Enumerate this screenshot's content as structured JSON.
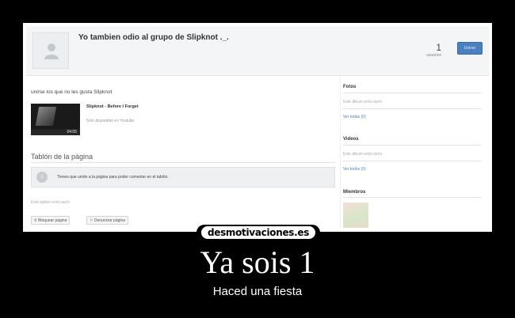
{
  "screenshot": {
    "group_title": "Yo tambien odio al grupo de Slipknot ._.",
    "member_count": "1",
    "member_label": "usuarios",
    "join_label": "Unirse",
    "description": "unirse los que no les gusta Slipknot",
    "video": {
      "title": "Slipknot - Before I Forget",
      "duration": "04:05",
      "note": "Sólo disponible en Youtube"
    },
    "wall": {
      "title": "Tablón de la página",
      "notice": "Tienes que unirte a la página para poder comentar en el tablón.",
      "empty": "Este tablón está vacío",
      "block_button": "Bloquear página",
      "report_button": "Denunciar página"
    },
    "sidebar": {
      "photos": {
        "title": "Fotos",
        "empty": "Este álbum está vacío",
        "link": "Ver todas (0)"
      },
      "videos": {
        "title": "Videos",
        "empty": "Este álbum está vacío",
        "link": "Ver todos (0)"
      },
      "members": {
        "title": "Miembros"
      }
    }
  },
  "poster": {
    "brand": "desmotivaciones.es",
    "caption": "Ya sois 1",
    "subcaption": "Haced una fiesta"
  },
  "colors": {
    "background": "#000000",
    "accent": "#4a7fc0"
  }
}
